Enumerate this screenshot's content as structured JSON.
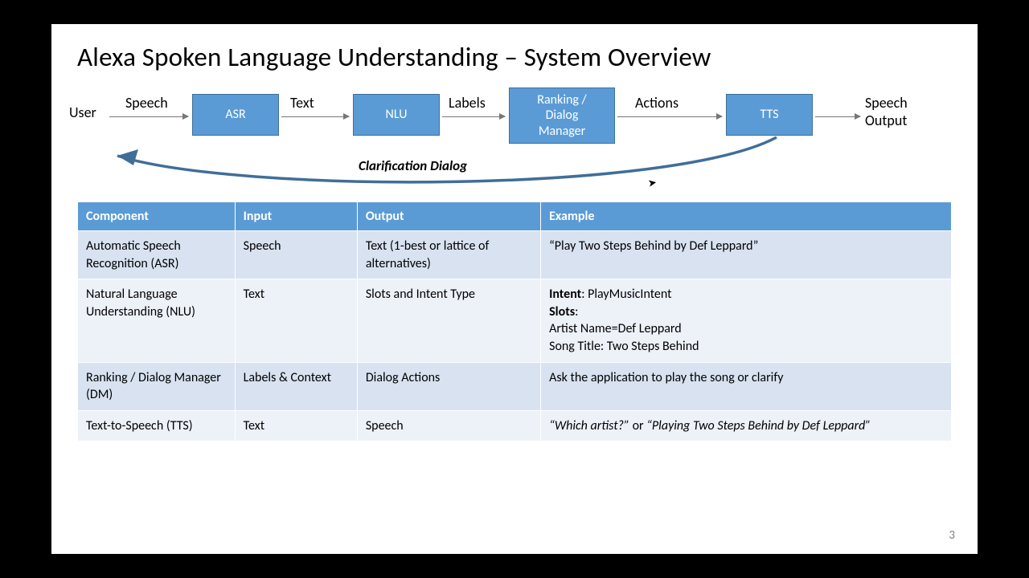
{
  "title": "Alexa Spoken Language Understanding – System Overview",
  "page_number": "3",
  "pipeline": {
    "start": "User",
    "end": "Speech\nOutput",
    "nodes": {
      "asr": "ASR",
      "nlu": "NLU",
      "dm": "Ranking /\nDialog\nManager",
      "tts": "TTS"
    },
    "edges": {
      "e1": "Speech",
      "e2": "Text",
      "e3": "Labels",
      "e4": "Actions"
    },
    "feedback_label": "Clarification Dialog"
  },
  "table": {
    "headers": {
      "component": "Component",
      "input": "Input",
      "output": "Output",
      "example": "Example"
    },
    "rows": [
      {
        "component": "Automatic Speech Recognition (ASR)",
        "input": "Speech",
        "output": "Text (1-best or lattice of alternatives)",
        "example": "“Play Two Steps Behind by Def Leppard”"
      },
      {
        "component": "Natural Language Understanding (NLU)",
        "input": "Text",
        "output": "Slots and Intent Type",
        "example_html": "<b>Intent</b>: PlayMusicIntent<br><b>Slots</b>:<br>Artist Name=Def Leppard<br>Song Title: Two Steps Behind"
      },
      {
        "component": "Ranking / Dialog Manager (DM)",
        "input": "Labels & Context",
        "output": "Dialog Actions",
        "example": "Ask the application to play the song or clarify"
      },
      {
        "component": "Text-to-Speech (TTS)",
        "input": "Text",
        "output": "Speech",
        "example_html": "<i>“Which artist?”</i> or <i>“Playing Two Steps Behind by Def Leppard”</i>"
      }
    ]
  },
  "colors": {
    "accent": "#5b9bd5",
    "accent_border": "#3f6e99",
    "row_odd": "#d8e2f0",
    "row_even": "#edf1f8"
  }
}
